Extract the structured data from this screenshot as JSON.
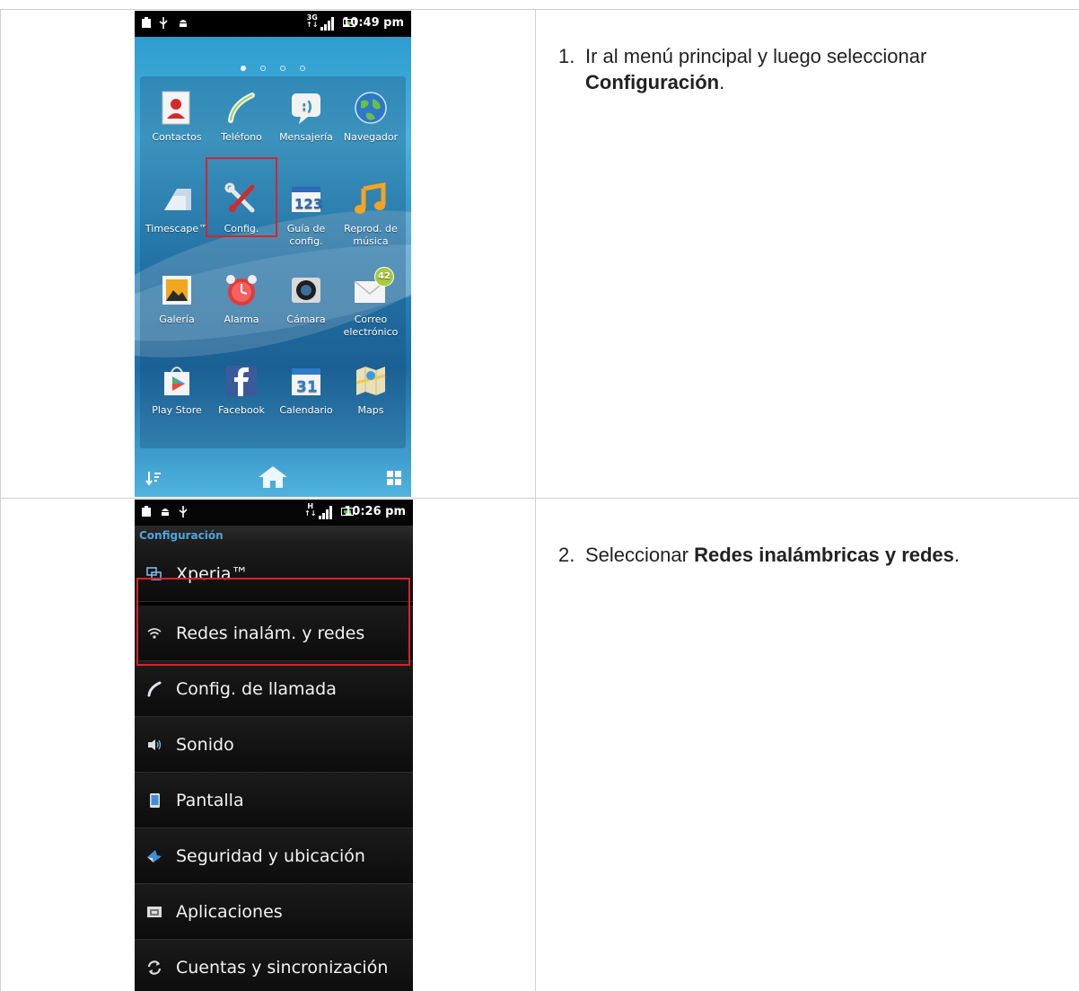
{
  "step1": {
    "number": "1.",
    "text": "Ir al menú principal y luego seleccionar",
    "bold": "Configuración",
    "suffix": "."
  },
  "step2": {
    "number": "2.",
    "text": "Seleccionar ",
    "bold": "Redes inalámbricas y redes",
    "suffix": "."
  },
  "phone1": {
    "time": "10:49 pm",
    "network": "3G",
    "apps": [
      {
        "label": "Contactos",
        "icon": "contacts-icon"
      },
      {
        "label": "Teléfono",
        "icon": "phone-icon"
      },
      {
        "label": "Mensajería",
        "icon": "messaging-icon"
      },
      {
        "label": "Navegador",
        "icon": "browser-icon"
      },
      {
        "label": "Timescape™",
        "icon": "timescape-icon"
      },
      {
        "label": "Config.",
        "icon": "settings-icon"
      },
      {
        "label": "Guía de config.",
        "icon": "setup-guide-icon"
      },
      {
        "label": "Reprod. de música",
        "icon": "music-icon"
      },
      {
        "label": "Galería",
        "icon": "gallery-icon"
      },
      {
        "label": "Alarma",
        "icon": "alarm-icon"
      },
      {
        "label": "Cámara",
        "icon": "camera-icon"
      },
      {
        "label": "Correo electrónico",
        "icon": "email-icon",
        "badge": "42"
      },
      {
        "label": "Play Store",
        "icon": "play-store-icon"
      },
      {
        "label": "Facebook",
        "icon": "facebook-icon"
      },
      {
        "label": "Calendario",
        "icon": "calendar-icon",
        "day": "31"
      },
      {
        "label": "Maps",
        "icon": "maps-icon"
      }
    ],
    "setup_guide_number": "123"
  },
  "phone2": {
    "time": "10:26 pm",
    "network": "H",
    "title": "Configuración",
    "items": [
      {
        "label": "Xperia™",
        "icon": "xperia-icon"
      },
      {
        "label": "Redes inalám. y redes",
        "icon": "wifi-icon"
      },
      {
        "label": "Config. de llamada",
        "icon": "phone-icon"
      },
      {
        "label": "Sonido",
        "icon": "speaker-icon"
      },
      {
        "label": "Pantalla",
        "icon": "display-icon"
      },
      {
        "label": "Seguridad y ubicación",
        "icon": "location-icon"
      },
      {
        "label": "Aplicaciones",
        "icon": "applications-icon"
      },
      {
        "label": "Cuentas y sincronización",
        "icon": "sync-icon"
      }
    ]
  },
  "colors": {
    "highlight": "#d9232a",
    "settings_title": "#4fa6dc"
  }
}
